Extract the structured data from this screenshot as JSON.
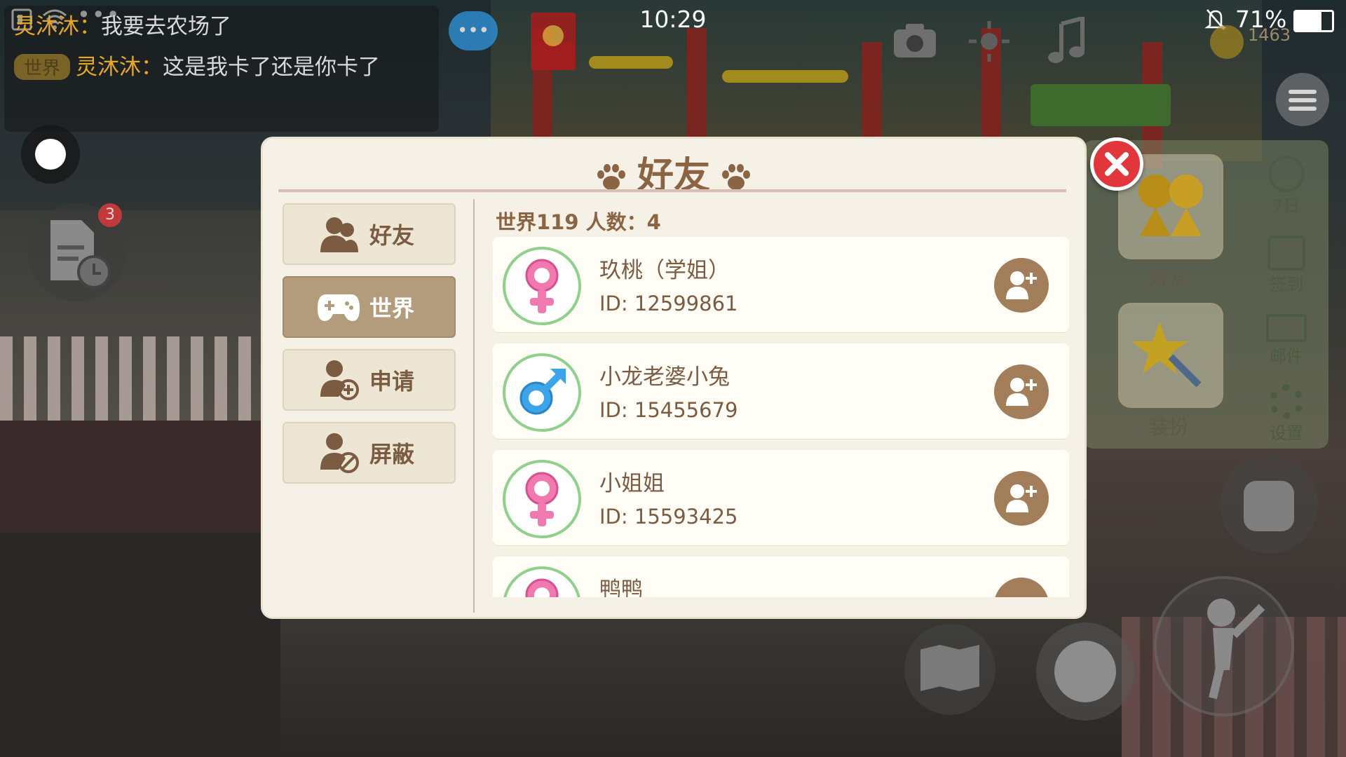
{
  "status_bar": {
    "time": "10:29",
    "battery_percent": "71%",
    "battery_level": 0.71
  },
  "chat": {
    "lines": [
      {
        "tag": "",
        "name": "灵沐沐：",
        "message": "我要去农场了"
      },
      {
        "tag": "世界",
        "name": "灵沐沐：",
        "message": "这是我卡了还是你卡了"
      }
    ]
  },
  "hud": {
    "notification_badge": "3",
    "coins": "1463"
  },
  "modal": {
    "title": "好友",
    "tabs": [
      {
        "label": "好友",
        "icon": "friends-icon",
        "active": false
      },
      {
        "label": "世界",
        "icon": "gamepad-icon",
        "active": true
      },
      {
        "label": "申请",
        "icon": "add-request-icon",
        "active": false
      },
      {
        "label": "屏蔽",
        "icon": "block-user-icon",
        "active": false
      }
    ],
    "list_header": "世界119  人数：4",
    "players": [
      {
        "name": "玖桃（学姐）",
        "id": "ID: 12599861",
        "gender": "female"
      },
      {
        "name": "小龙老婆小兔",
        "id": "ID: 15455679",
        "gender": "male"
      },
      {
        "name": "小姐姐",
        "id": "ID: 15593425",
        "gender": "female"
      },
      {
        "name": "鸭鸭",
        "id": "",
        "gender": "female"
      }
    ]
  },
  "right_panel": {
    "friends_label": "好友",
    "dressup_label": "装扮",
    "side_items": [
      "7日",
      "签到",
      "邮件",
      "设置"
    ]
  },
  "colors": {
    "accent_brown": "#8a6443",
    "active_tab": "#b29c7b",
    "close_red": "#e0363c",
    "female_pink": "#f07ab0",
    "male_blue": "#3ca4e8",
    "avatar_ring": "#8fd08b"
  }
}
